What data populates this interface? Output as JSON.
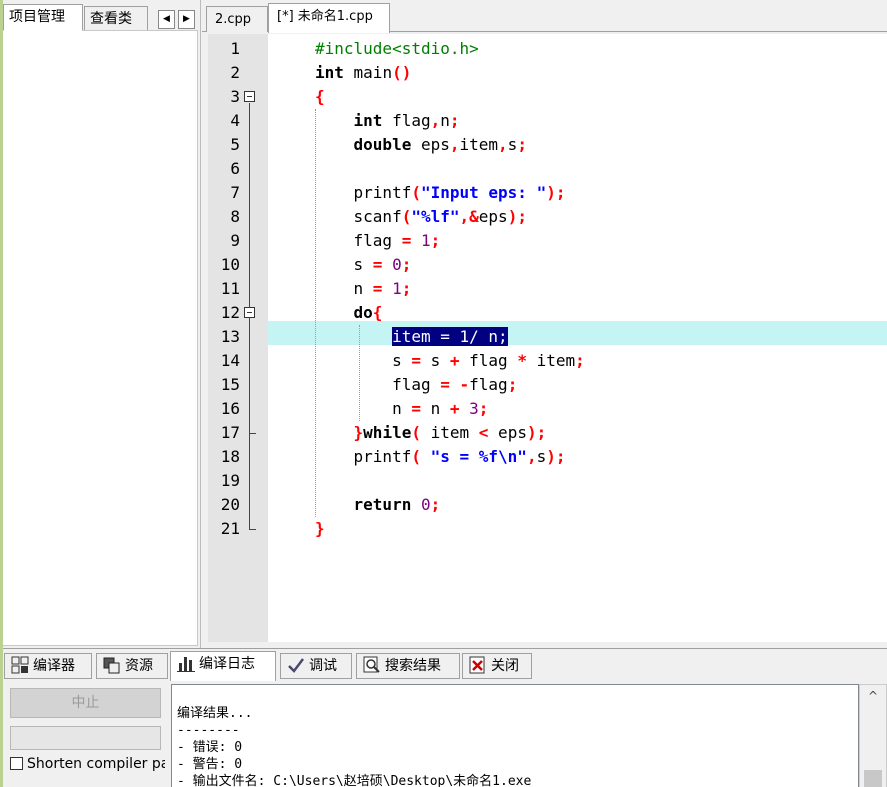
{
  "left_panel": {
    "tabs": [
      {
        "label": "项目管理"
      },
      {
        "label": "查看类"
      }
    ],
    "arrow_left": "◀",
    "arrow_right": "▶"
  },
  "editor_tabs": [
    {
      "label": "2.cpp"
    },
    {
      "label": "[*] 未命名1.cpp"
    }
  ],
  "editor": {
    "line_numbers": [
      "1",
      "2",
      "3",
      "4",
      "5",
      "6",
      "7",
      "8",
      "9",
      "10",
      "11",
      "12",
      "13",
      "14",
      "15",
      "16",
      "17",
      "18",
      "19",
      "20",
      "21"
    ],
    "lines": [
      [
        [
          "pp",
          "#include<stdio.h>"
        ]
      ],
      [
        [
          "kw",
          "int"
        ],
        [
          "id",
          " main"
        ],
        [
          "sym",
          "()"
        ]
      ],
      [
        [
          "sym",
          "{"
        ]
      ],
      [
        [
          "id",
          "    "
        ],
        [
          "kw",
          "int"
        ],
        [
          "id",
          " flag"
        ],
        [
          "sym",
          ","
        ],
        [
          "id",
          "n"
        ],
        [
          "sym",
          ";"
        ]
      ],
      [
        [
          "id",
          "    "
        ],
        [
          "kw",
          "double"
        ],
        [
          "id",
          " eps"
        ],
        [
          "sym",
          ","
        ],
        [
          "id",
          "item"
        ],
        [
          "sym",
          ","
        ],
        [
          "id",
          "s"
        ],
        [
          "sym",
          ";"
        ]
      ],
      [],
      [
        [
          "id",
          "    printf"
        ],
        [
          "sym",
          "("
        ],
        [
          "str",
          "\"Input eps: \""
        ],
        [
          "sym",
          ");"
        ]
      ],
      [
        [
          "id",
          "    scanf"
        ],
        [
          "sym",
          "("
        ],
        [
          "str",
          "\"%lf\""
        ],
        [
          "sym",
          ",&"
        ],
        [
          "id",
          "eps"
        ],
        [
          "sym",
          ");"
        ]
      ],
      [
        [
          "id",
          "    flag "
        ],
        [
          "sym",
          "="
        ],
        [
          "id",
          " "
        ],
        [
          "num",
          "1"
        ],
        [
          "sym",
          ";"
        ]
      ],
      [
        [
          "id",
          "    s "
        ],
        [
          "sym",
          "="
        ],
        [
          "id",
          " "
        ],
        [
          "num",
          "0"
        ],
        [
          "sym",
          ";"
        ]
      ],
      [
        [
          "id",
          "    n "
        ],
        [
          "sym",
          "="
        ],
        [
          "id",
          " "
        ],
        [
          "num",
          "1"
        ],
        [
          "sym",
          ";"
        ]
      ],
      [
        [
          "id",
          "    "
        ],
        [
          "kw",
          "do"
        ],
        [
          "sym",
          "{"
        ]
      ],
      [
        [
          "id",
          "        "
        ],
        [
          "sel",
          "item = 1/ n;"
        ]
      ],
      [
        [
          "id",
          "        s "
        ],
        [
          "sym",
          "="
        ],
        [
          "id",
          " s "
        ],
        [
          "sym",
          "+"
        ],
        [
          "id",
          " flag "
        ],
        [
          "sym",
          "*"
        ],
        [
          "id",
          " item"
        ],
        [
          "sym",
          ";"
        ]
      ],
      [
        [
          "id",
          "        flag "
        ],
        [
          "sym",
          "="
        ],
        [
          "id",
          " "
        ],
        [
          "sym",
          "-"
        ],
        [
          "id",
          "flag"
        ],
        [
          "sym",
          ";"
        ]
      ],
      [
        [
          "id",
          "        n "
        ],
        [
          "sym",
          "="
        ],
        [
          "id",
          " n "
        ],
        [
          "sym",
          "+"
        ],
        [
          "id",
          " "
        ],
        [
          "num",
          "3"
        ],
        [
          "sym",
          ";"
        ]
      ],
      [
        [
          "id",
          "    "
        ],
        [
          "sym",
          "}"
        ],
        [
          "kw",
          "while"
        ],
        [
          "sym",
          "("
        ],
        [
          "id",
          " item "
        ],
        [
          "sym",
          "<"
        ],
        [
          "id",
          " eps"
        ],
        [
          "sym",
          ");"
        ]
      ],
      [
        [
          "id",
          "    printf"
        ],
        [
          "sym",
          "("
        ],
        [
          "id",
          " "
        ],
        [
          "str",
          "\"s = %f\\n\""
        ],
        [
          "sym",
          ","
        ],
        [
          "id",
          "s"
        ],
        [
          "sym",
          ");"
        ]
      ],
      [],
      [
        [
          "id",
          "    "
        ],
        [
          "kw",
          "return"
        ],
        [
          "id",
          " "
        ],
        [
          "num",
          "0"
        ],
        [
          "sym",
          ";"
        ]
      ],
      [
        [
          "sym",
          "}"
        ]
      ]
    ]
  },
  "bottom_tabs": [
    {
      "label": "编译器",
      "icon": "grid-icon"
    },
    {
      "label": "资源",
      "icon": "resources-icon"
    },
    {
      "label": "编译日志",
      "icon": "bar-chart-icon"
    },
    {
      "label": "调试",
      "icon": "checkmark-icon"
    },
    {
      "label": "搜索结果",
      "icon": "search-results-icon"
    },
    {
      "label": "关闭",
      "icon": "close-icon"
    }
  ],
  "compile": {
    "stop_label": "中止",
    "shorten_label": "Shorten compiler pa",
    "log_lines": [
      "编译结果...",
      "--------",
      "- 错误: 0",
      "- 警告: 0",
      "- 输出文件名: C:\\Users\\赵培硕\\Desktop\\未命名1.exe"
    ]
  },
  "scroll_up_glyph": "^",
  "colors": {
    "highlight_line": "#c4f4f4",
    "selection": "#000080",
    "keyword": "#000000",
    "preprocessor": "#008000",
    "string": "#0000ff",
    "number": "#800080",
    "symbol": "#ff0000"
  }
}
